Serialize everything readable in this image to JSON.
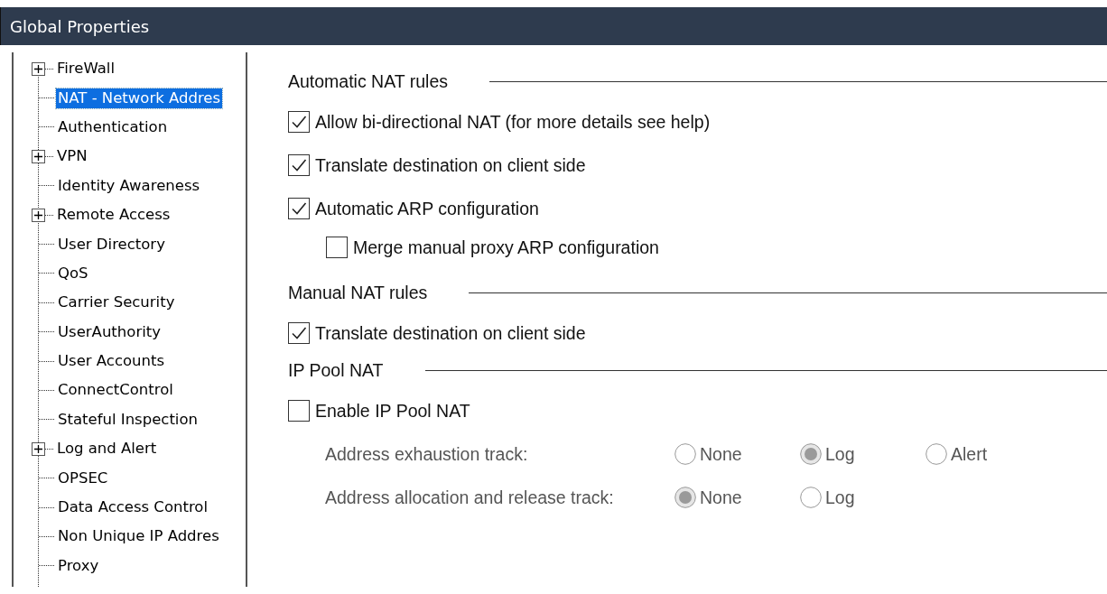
{
  "window": {
    "title": "Global Properties"
  },
  "tree": [
    {
      "label": "FireWall",
      "kind": "folder",
      "selected": false
    },
    {
      "label": "NAT - Network Addres",
      "kind": "leaf",
      "selected": true
    },
    {
      "label": "Authentication",
      "kind": "leaf",
      "selected": false
    },
    {
      "label": "VPN",
      "kind": "folder",
      "selected": false
    },
    {
      "label": "Identity Awareness",
      "kind": "leaf",
      "selected": false
    },
    {
      "label": "Remote Access",
      "kind": "folder",
      "selected": false
    },
    {
      "label": "User Directory",
      "kind": "leaf",
      "selected": false
    },
    {
      "label": "QoS",
      "kind": "leaf",
      "selected": false
    },
    {
      "label": "Carrier Security",
      "kind": "leaf",
      "selected": false
    },
    {
      "label": "UserAuthority",
      "kind": "leaf",
      "selected": false
    },
    {
      "label": "User Accounts",
      "kind": "leaf",
      "selected": false
    },
    {
      "label": "ConnectControl",
      "kind": "leaf",
      "selected": false
    },
    {
      "label": "Stateful Inspection",
      "kind": "leaf",
      "selected": false
    },
    {
      "label": "Log and Alert",
      "kind": "folder",
      "selected": false
    },
    {
      "label": "OPSEC",
      "kind": "leaf",
      "selected": false
    },
    {
      "label": "Data Access Control",
      "kind": "leaf",
      "selected": false
    },
    {
      "label": "Non Unique IP Addres",
      "kind": "leaf",
      "selected": false
    },
    {
      "label": "Proxy",
      "kind": "leaf",
      "selected": false
    }
  ],
  "sections": [
    {
      "title": "Automatic NAT rules",
      "options": [
        {
          "kind": "checkbox",
          "label": "Allow bi-directional NAT  (for more details see help)",
          "checked": true
        },
        {
          "kind": "checkbox",
          "label": "Translate destination on client side",
          "checked": true
        },
        {
          "kind": "checkbox",
          "label": "Automatic ARP configuration",
          "checked": true
        },
        {
          "kind": "sub-checkbox",
          "label": "Merge manual proxy ARP configuration",
          "checked": false
        }
      ]
    },
    {
      "title": "Manual NAT rules",
      "options": [
        {
          "kind": "checkbox",
          "label": "Translate destination on client side",
          "checked": true
        }
      ]
    },
    {
      "title": "IP Pool NAT",
      "options": [
        {
          "kind": "checkbox",
          "label": "Enable IP Pool NAT",
          "checked": false
        },
        {
          "kind": "radio-group",
          "label": "Address exhaustion track:",
          "disabled": true,
          "choices": [
            {
              "label": "None",
              "selected": false
            },
            {
              "label": "Log",
              "selected": true
            },
            {
              "label": "Alert",
              "selected": false
            }
          ]
        },
        {
          "kind": "radio-group",
          "label": "Address allocation and release track:",
          "disabled": true,
          "choices": [
            {
              "label": "None",
              "selected": true
            },
            {
              "label": "Log",
              "selected": false
            }
          ]
        }
      ]
    }
  ]
}
